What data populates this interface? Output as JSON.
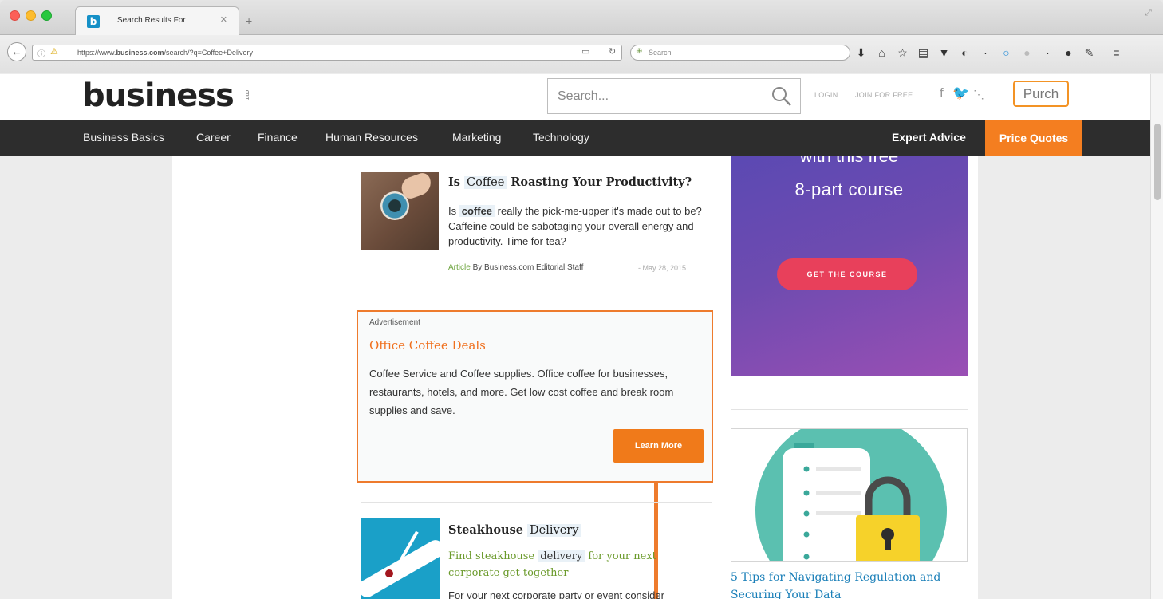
{
  "browser": {
    "tab_title": "Search Results For",
    "tab_favicon": "b",
    "url_prefix": "https://www.",
    "url_domain": "business.com",
    "url_path": "/search/?q=Coffee+Delivery",
    "search_placeholder": "Search"
  },
  "header": {
    "logo": "business",
    "logo_suffix": ".com",
    "search_placeholder": "Search...",
    "login": "LOGIN",
    "join": "JOIN FOR FREE",
    "purch": "Purch"
  },
  "nav": {
    "items": [
      "Business Basics",
      "Career",
      "Finance",
      "Human Resources",
      "Marketing",
      "Technology"
    ],
    "expert": "Expert Advice",
    "price": "Price Quotes"
  },
  "articles": [
    {
      "title_pre": "Is",
      "title_hl": "Coffee",
      "title_post": "Roasting Your Productivity?",
      "desc_pre": "Is",
      "desc_hl": "coffee",
      "desc_post": "really the pick-me-upper it's made out to be? Caffeine could be sabotaging your overall energy and productivity. Time for tea?",
      "type": "Article",
      "author": "By Business.com Editorial Staff",
      "date": "- May 28, 2015"
    },
    {
      "title": "Steakhouse",
      "title_hl": "Delivery",
      "sub_pre": "Find steakhouse",
      "sub_hl": "delivery",
      "sub_post": "for your next corporate get together",
      "desc": "For your next corporate party or event consider"
    }
  ],
  "ad": {
    "label": "Advertisement",
    "title": "Office Coffee Deals",
    "text": "Coffee Service and Coffee supplies. Office coffee for businesses, restaurants, hotels, and more. Get low cost coffee and break room supplies and save.",
    "button": "Learn More",
    "accent": "#ee7b2d"
  },
  "sidebar": {
    "promo_top": "with this free",
    "promo_course": "8-part course",
    "promo_button": "GET THE COURSE",
    "card_title": "5 Tips for Navigating Regulation and Securing Your Data"
  }
}
